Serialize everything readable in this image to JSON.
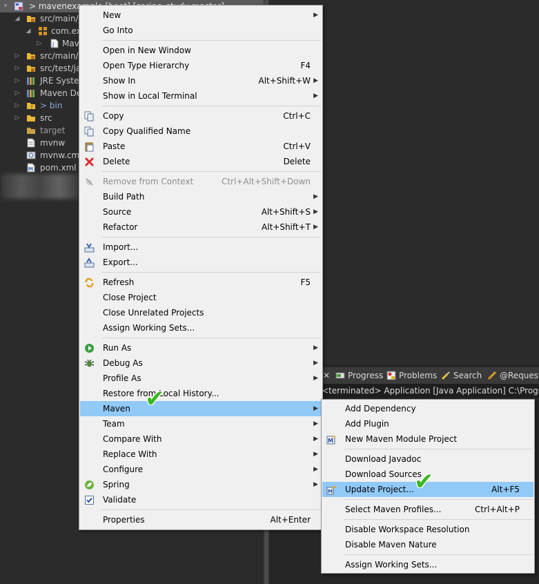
{
  "explorer": {
    "rows": [
      {
        "twisty": "▾",
        "label": "> mavenexample [boot] [spring_study master]"
      },
      {
        "twisty": "◢",
        "label": "src/main/j"
      },
      {
        "twisty": "◢",
        "label": "com.ex"
      },
      {
        "twisty": "▷",
        "label": "Mav"
      },
      {
        "twisty": "▷",
        "label": "src/main/r"
      },
      {
        "twisty": "▷",
        "label": "src/test/jav"
      },
      {
        "twisty": "▷",
        "label": "JRE System"
      },
      {
        "twisty": "▷",
        "label": "Maven De"
      },
      {
        "twisty": "▷",
        "label": "> bin"
      },
      {
        "twisty": "▷",
        "label": "src"
      },
      {
        "twisty": "",
        "label": "target"
      },
      {
        "twisty": "",
        "label": "mvnw"
      },
      {
        "twisty": "",
        "label": "mvnw.cmd"
      },
      {
        "twisty": "",
        "label": "pom.xml"
      }
    ]
  },
  "context_menu": {
    "items": [
      {
        "label": "New",
        "accel": ""
      },
      {
        "label": "Go Into",
        "accel": ""
      },
      {
        "label": "Open in New Window",
        "accel": ""
      },
      {
        "label": "Open Type Hierarchy",
        "accel": "F4"
      },
      {
        "label": "Show In",
        "accel": "Alt+Shift+W"
      },
      {
        "label": "Show in Local Terminal",
        "accel": ""
      },
      {
        "label": "Copy",
        "accel": "Ctrl+C"
      },
      {
        "label": "Copy Qualified Name",
        "accel": ""
      },
      {
        "label": "Paste",
        "accel": "Ctrl+V"
      },
      {
        "label": "Delete",
        "accel": "Delete"
      },
      {
        "label": "Remove from Context",
        "accel": "Ctrl+Alt+Shift+Down"
      },
      {
        "label": "Build Path",
        "accel": ""
      },
      {
        "label": "Source",
        "accel": "Alt+Shift+S"
      },
      {
        "label": "Refactor",
        "accel": "Alt+Shift+T"
      },
      {
        "label": "Import...",
        "accel": ""
      },
      {
        "label": "Export...",
        "accel": ""
      },
      {
        "label": "Refresh",
        "accel": "F5"
      },
      {
        "label": "Close Project",
        "accel": ""
      },
      {
        "label": "Close Unrelated Projects",
        "accel": ""
      },
      {
        "label": "Assign Working Sets...",
        "accel": ""
      },
      {
        "label": "Run As",
        "accel": ""
      },
      {
        "label": "Debug As",
        "accel": ""
      },
      {
        "label": "Profile As",
        "accel": ""
      },
      {
        "label": "Restore from Local History...",
        "accel": ""
      },
      {
        "label": "Maven",
        "accel": ""
      },
      {
        "label": "Team",
        "accel": ""
      },
      {
        "label": "Compare With",
        "accel": ""
      },
      {
        "label": "Replace With",
        "accel": ""
      },
      {
        "label": "Configure",
        "accel": ""
      },
      {
        "label": "Spring",
        "accel": ""
      },
      {
        "label": "Validate",
        "accel": ""
      },
      {
        "label": "Properties",
        "accel": "Alt+Enter"
      }
    ]
  },
  "maven_submenu": {
    "items": [
      {
        "label": "Add Dependency",
        "accel": ""
      },
      {
        "label": "Add Plugin",
        "accel": ""
      },
      {
        "label": "New Maven Module Project",
        "accel": ""
      },
      {
        "label": "Download Javadoc",
        "accel": ""
      },
      {
        "label": "Download Sources",
        "accel": ""
      },
      {
        "label": "Update Project...",
        "accel": "Alt+F5"
      },
      {
        "label": "Select Maven Profiles...",
        "accel": "Ctrl+Alt+P"
      },
      {
        "label": "Disable Workspace Resolution",
        "accel": ""
      },
      {
        "label": "Disable Maven Nature",
        "accel": ""
      },
      {
        "label": "Assign Working Sets...",
        "accel": ""
      }
    ]
  },
  "console": {
    "close_glyph": "✕",
    "tabs": [
      "Progress",
      "Problems",
      "Search",
      "@Request"
    ],
    "line": "<terminated> Application [Java Application] C:\\Program Files\\Java\\jdk"
  },
  "colors": {
    "highlight": "#91c9f7",
    "check": "#39b820"
  }
}
